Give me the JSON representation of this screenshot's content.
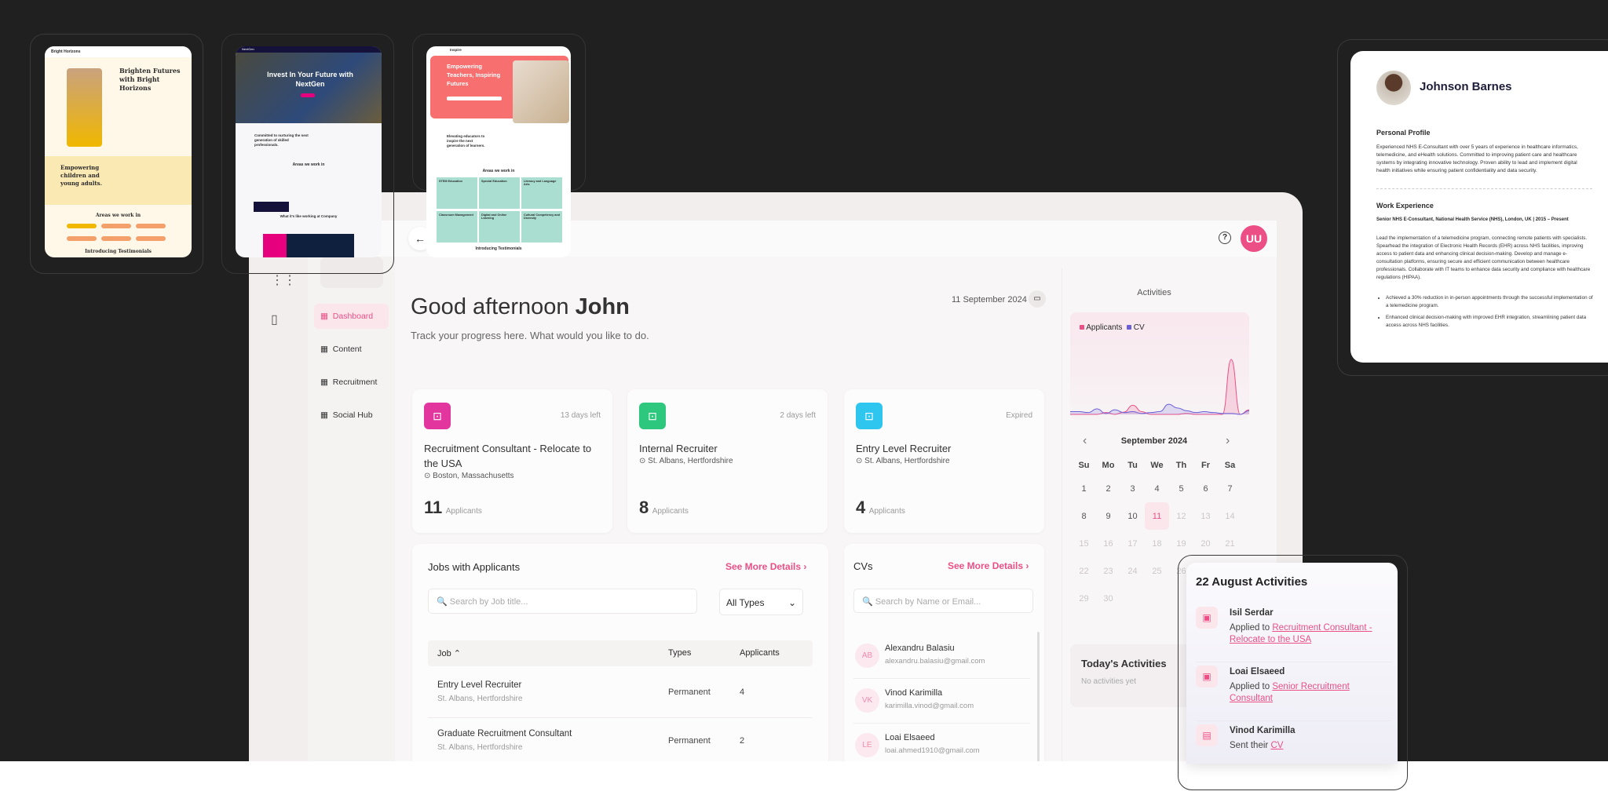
{
  "thumbnails": [
    {
      "brand": "Bright Horizons",
      "headline": "Brighten Futures with Bright Horizons",
      "section": "Empowering children and young adults.",
      "areas_title": "Areas we work in",
      "footer": "Introducing Testimonials",
      "accent": "#f4a06b",
      "bg": "#fff8e8"
    },
    {
      "brand": "NextGen",
      "headline": "Invest In Your Future with NextGen",
      "section": "Committed to nurturing the next generation of skilled professionals.",
      "areas_title": "Areas we work in",
      "footer": "What it's like working at Company",
      "accent": "#e6007e",
      "bg": "#f7f7f9"
    },
    {
      "brand": "Inspire",
      "headline": "Empowering Teachers, Inspiring Futures",
      "section": "Elevating educators to inspire the next generation of learners.",
      "areas_title": "Areas we work in",
      "areas": [
        "STEM Education",
        "Special Education",
        "Literacy and Language Arts",
        "Classroom Management",
        "Digital and Online Learning",
        "Cultural Competency and Diversity"
      ],
      "footer": "Introducing Testimonials",
      "accent": "#f7706f",
      "bg": "#ffffff"
    }
  ],
  "resume": {
    "name": "Johnson Barnes",
    "profile_title": "Personal Profile",
    "profile_text": "Experienced NHS E-Consultant with over 5 years of experience in healthcare informatics, telemedicine, and eHealth solutions. Committed to improving patient care and healthcare systems by integrating innovative technology. Proven ability to lead and implement digital health initiatives while ensuring patient confidentiality and data security.",
    "work_title": "Work Experience",
    "role": "Senior NHS E-Consultant, National Health Service (NHS), London, UK | 2015 – Present",
    "role_text": "Lead the implementation of a telemedicine program, connecting remote patients with specialists. Spearhead the integration of Electronic Health Records (EHR) across NHS facilities, improving access to patient data and enhancing clinical decision-making. Develop and manage e-consultation platforms, ensuring secure and efficient communication between healthcare professionals. Collaborate with IT teams to enhance data security and compliance with healthcare regulations (HIPAA).",
    "bullets": [
      "Achieved a 30% reduction in in-person appointments through the successful implementation of a telemedicine program.",
      "Enhanced clinical decision-making with improved EHR integration, streamlining patient data access across NHS facilities."
    ]
  },
  "header": {
    "back_icon": "arrow-left-icon",
    "help_icon": "question-circle-icon",
    "avatar": "UU"
  },
  "sidebar": {
    "items": [
      {
        "label": "Dashboard",
        "icon": "grid-icon",
        "active": true
      },
      {
        "label": "Content",
        "icon": "layout-icon"
      },
      {
        "label": "Recruitment",
        "icon": "clipboard-icon"
      },
      {
        "label": "Social Hub",
        "icon": "heart-icon"
      }
    ]
  },
  "greeting": {
    "prefix": "Good afternoon",
    "name": "John",
    "subtitle": "Track your progress here. What would you like to do.",
    "date": "11 September 2024"
  },
  "job_cards": [
    {
      "title": "Recruitment Consultant - Relocate to the USA",
      "location": "Boston, Massachusetts",
      "status": "13 days left",
      "count": "11",
      "count_label": "Applicants",
      "color": "#e3359e"
    },
    {
      "title": "Internal Recruiter",
      "location": "St. Albans, Hertfordshire",
      "status": "2 days left",
      "count": "8",
      "count_label": "Applicants",
      "color": "#2dc77e"
    },
    {
      "title": "Entry Level Recruiter",
      "location": "St. Albans, Hertfordshire",
      "status": "Expired",
      "count": "4",
      "count_label": "Applicants",
      "color": "#2ec6ef"
    }
  ],
  "jobs": {
    "title": "Jobs with Applicants",
    "more": "See More Details",
    "search_placeholder": "Search by Job title...",
    "type_filter": "All Types",
    "columns": [
      "Job",
      "Types",
      "Applicants"
    ],
    "rows": [
      {
        "job": "Entry Level Recruiter",
        "location": "St. Albans, Hertfordshire",
        "type": "Permanent",
        "applicants": "4"
      },
      {
        "job": "Graduate Recruitment Consultant",
        "location": "St. Albans, Hertfordshire",
        "type": "Permanent",
        "applicants": "2"
      }
    ]
  },
  "cvs": {
    "title": "CVs",
    "more": "See More Details",
    "search_placeholder": "Search by Name or Email...",
    "items": [
      {
        "initials": "AB",
        "name": "Alexandru Balasiu",
        "email": "alexandru.balasiu@gmail.com"
      },
      {
        "initials": "VK",
        "name": "Vinod Karimilla",
        "email": "karimilla.vinod@gmail.com"
      },
      {
        "initials": "LE",
        "name": "Loai Elsaeed",
        "email": "loai.ahmed1910@gmail.com"
      }
    ]
  },
  "activities": {
    "title": "Activities",
    "legend": [
      {
        "name": "Applicants",
        "color": "#ec4f86"
      },
      {
        "name": "CV",
        "color": "#6a5fd6"
      }
    ],
    "chart_data": {
      "type": "area",
      "series": [
        {
          "name": "Applicants",
          "values": [
            0,
            0,
            0,
            0,
            0.2,
            0,
            0.25,
            1,
            0.3,
            0,
            0,
            0,
            0,
            0.1,
            0,
            0,
            0,
            0,
            6,
            0,
            0.5
          ]
        },
        {
          "name": "CV",
          "values": [
            0.3,
            0.3,
            0.2,
            0.6,
            0.1,
            0.5,
            0.2,
            0.3,
            0.1,
            0.2,
            0.3,
            1.1,
            0.7,
            0.4,
            0.2,
            0.3,
            0.2,
            0.1,
            0.1,
            0,
            0.4
          ]
        }
      ]
    },
    "month": "September 2024",
    "weekdays": [
      "Su",
      "Mo",
      "Tu",
      "We",
      "Th",
      "Fr",
      "Sa"
    ],
    "today": 11,
    "today_title": "Today's Activities",
    "today_empty": "No activities yet"
  },
  "popup": {
    "title": "22 August Activities",
    "items": [
      {
        "name": "Isil Serdar",
        "action": "Applied to",
        "target": "Recruitment Consultant - Relocate to the USA",
        "icon": "briefcase-icon"
      },
      {
        "name": "Loai Elsaeed",
        "action": "Applied to",
        "target": "Senior Recruitment Consultant",
        "icon": "briefcase-icon"
      },
      {
        "name": "Vinod Karimilla",
        "action": "Sent their",
        "target": "CV",
        "icon": "file-upload-icon"
      }
    ]
  }
}
